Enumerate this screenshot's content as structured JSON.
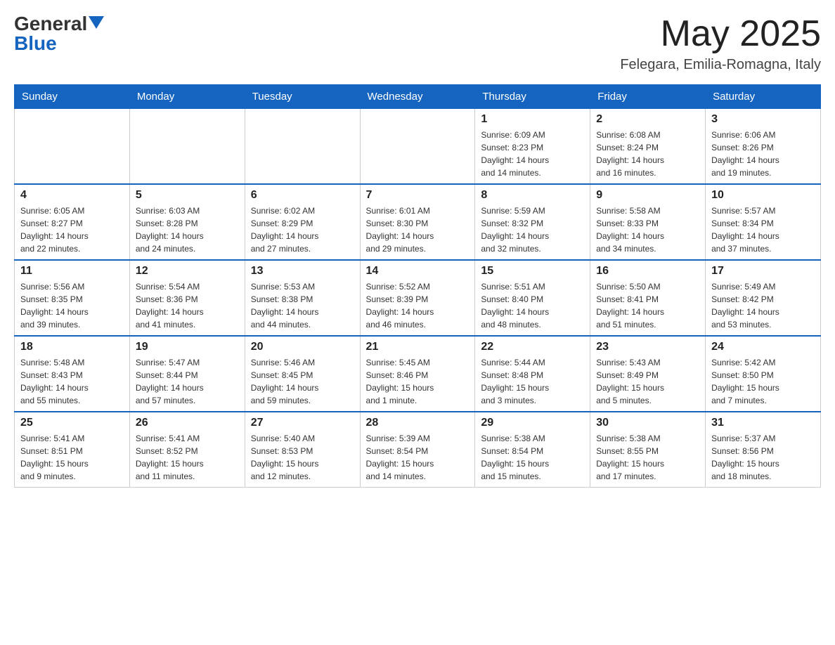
{
  "header": {
    "logo_general": "General",
    "logo_blue": "Blue",
    "month_title": "May 2025",
    "location": "Felegara, Emilia-Romagna, Italy"
  },
  "weekdays": [
    "Sunday",
    "Monday",
    "Tuesday",
    "Wednesday",
    "Thursday",
    "Friday",
    "Saturday"
  ],
  "weeks": [
    [
      {
        "day": "",
        "info": ""
      },
      {
        "day": "",
        "info": ""
      },
      {
        "day": "",
        "info": ""
      },
      {
        "day": "",
        "info": ""
      },
      {
        "day": "1",
        "info": "Sunrise: 6:09 AM\nSunset: 8:23 PM\nDaylight: 14 hours\nand 14 minutes."
      },
      {
        "day": "2",
        "info": "Sunrise: 6:08 AM\nSunset: 8:24 PM\nDaylight: 14 hours\nand 16 minutes."
      },
      {
        "day": "3",
        "info": "Sunrise: 6:06 AM\nSunset: 8:26 PM\nDaylight: 14 hours\nand 19 minutes."
      }
    ],
    [
      {
        "day": "4",
        "info": "Sunrise: 6:05 AM\nSunset: 8:27 PM\nDaylight: 14 hours\nand 22 minutes."
      },
      {
        "day": "5",
        "info": "Sunrise: 6:03 AM\nSunset: 8:28 PM\nDaylight: 14 hours\nand 24 minutes."
      },
      {
        "day": "6",
        "info": "Sunrise: 6:02 AM\nSunset: 8:29 PM\nDaylight: 14 hours\nand 27 minutes."
      },
      {
        "day": "7",
        "info": "Sunrise: 6:01 AM\nSunset: 8:30 PM\nDaylight: 14 hours\nand 29 minutes."
      },
      {
        "day": "8",
        "info": "Sunrise: 5:59 AM\nSunset: 8:32 PM\nDaylight: 14 hours\nand 32 minutes."
      },
      {
        "day": "9",
        "info": "Sunrise: 5:58 AM\nSunset: 8:33 PM\nDaylight: 14 hours\nand 34 minutes."
      },
      {
        "day": "10",
        "info": "Sunrise: 5:57 AM\nSunset: 8:34 PM\nDaylight: 14 hours\nand 37 minutes."
      }
    ],
    [
      {
        "day": "11",
        "info": "Sunrise: 5:56 AM\nSunset: 8:35 PM\nDaylight: 14 hours\nand 39 minutes."
      },
      {
        "day": "12",
        "info": "Sunrise: 5:54 AM\nSunset: 8:36 PM\nDaylight: 14 hours\nand 41 minutes."
      },
      {
        "day": "13",
        "info": "Sunrise: 5:53 AM\nSunset: 8:38 PM\nDaylight: 14 hours\nand 44 minutes."
      },
      {
        "day": "14",
        "info": "Sunrise: 5:52 AM\nSunset: 8:39 PM\nDaylight: 14 hours\nand 46 minutes."
      },
      {
        "day": "15",
        "info": "Sunrise: 5:51 AM\nSunset: 8:40 PM\nDaylight: 14 hours\nand 48 minutes."
      },
      {
        "day": "16",
        "info": "Sunrise: 5:50 AM\nSunset: 8:41 PM\nDaylight: 14 hours\nand 51 minutes."
      },
      {
        "day": "17",
        "info": "Sunrise: 5:49 AM\nSunset: 8:42 PM\nDaylight: 14 hours\nand 53 minutes."
      }
    ],
    [
      {
        "day": "18",
        "info": "Sunrise: 5:48 AM\nSunset: 8:43 PM\nDaylight: 14 hours\nand 55 minutes."
      },
      {
        "day": "19",
        "info": "Sunrise: 5:47 AM\nSunset: 8:44 PM\nDaylight: 14 hours\nand 57 minutes."
      },
      {
        "day": "20",
        "info": "Sunrise: 5:46 AM\nSunset: 8:45 PM\nDaylight: 14 hours\nand 59 minutes."
      },
      {
        "day": "21",
        "info": "Sunrise: 5:45 AM\nSunset: 8:46 PM\nDaylight: 15 hours\nand 1 minute."
      },
      {
        "day": "22",
        "info": "Sunrise: 5:44 AM\nSunset: 8:48 PM\nDaylight: 15 hours\nand 3 minutes."
      },
      {
        "day": "23",
        "info": "Sunrise: 5:43 AM\nSunset: 8:49 PM\nDaylight: 15 hours\nand 5 minutes."
      },
      {
        "day": "24",
        "info": "Sunrise: 5:42 AM\nSunset: 8:50 PM\nDaylight: 15 hours\nand 7 minutes."
      }
    ],
    [
      {
        "day": "25",
        "info": "Sunrise: 5:41 AM\nSunset: 8:51 PM\nDaylight: 15 hours\nand 9 minutes."
      },
      {
        "day": "26",
        "info": "Sunrise: 5:41 AM\nSunset: 8:52 PM\nDaylight: 15 hours\nand 11 minutes."
      },
      {
        "day": "27",
        "info": "Sunrise: 5:40 AM\nSunset: 8:53 PM\nDaylight: 15 hours\nand 12 minutes."
      },
      {
        "day": "28",
        "info": "Sunrise: 5:39 AM\nSunset: 8:54 PM\nDaylight: 15 hours\nand 14 minutes."
      },
      {
        "day": "29",
        "info": "Sunrise: 5:38 AM\nSunset: 8:54 PM\nDaylight: 15 hours\nand 15 minutes."
      },
      {
        "day": "30",
        "info": "Sunrise: 5:38 AM\nSunset: 8:55 PM\nDaylight: 15 hours\nand 17 minutes."
      },
      {
        "day": "31",
        "info": "Sunrise: 5:37 AM\nSunset: 8:56 PM\nDaylight: 15 hours\nand 18 minutes."
      }
    ]
  ]
}
